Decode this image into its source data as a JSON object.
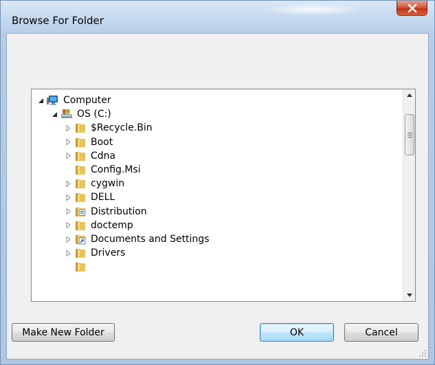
{
  "window": {
    "title": "Browse For Folder"
  },
  "tree": {
    "items": [
      {
        "label": "Computer",
        "icon": "computer-icon",
        "expanded": true,
        "has_children": true
      },
      {
        "label": "OS (C:)",
        "icon": "drive-icon",
        "expanded": true,
        "has_children": true
      },
      {
        "label": "$Recycle.Bin",
        "icon": "folder-icon",
        "expanded": false,
        "has_children": true
      },
      {
        "label": "Boot",
        "icon": "folder-icon",
        "expanded": false,
        "has_children": true
      },
      {
        "label": "Cdna",
        "icon": "folder-icon",
        "expanded": false,
        "has_children": true
      },
      {
        "label": "Config.Msi",
        "icon": "folder-icon",
        "expanded": false,
        "has_children": false
      },
      {
        "label": "cygwin",
        "icon": "folder-icon",
        "expanded": false,
        "has_children": true
      },
      {
        "label": "DELL",
        "icon": "folder-icon",
        "expanded": false,
        "has_children": true
      },
      {
        "label": "Distribution",
        "icon": "special-folder-icon",
        "expanded": false,
        "has_children": true
      },
      {
        "label": "doctemp",
        "icon": "folder-icon",
        "expanded": false,
        "has_children": true
      },
      {
        "label": "Documents and Settings",
        "icon": "shortcut-folder-icon",
        "expanded": false,
        "has_children": true
      },
      {
        "label": "Drivers",
        "icon": "folder-icon",
        "expanded": false,
        "has_children": true
      }
    ]
  },
  "buttons": {
    "make_new_folder": "Make New Folder",
    "ok": "OK",
    "cancel": "Cancel"
  },
  "colors": {
    "titlebar": "#c8dbef",
    "close_button": "#c5321a",
    "folder": "#e8c25a",
    "default_button_border": "#3c7fb1"
  }
}
